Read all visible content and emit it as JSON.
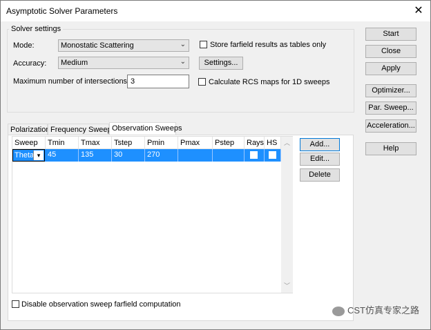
{
  "window": {
    "title": "Asymptotic Solver Parameters",
    "close_glyph": "✕"
  },
  "solver_settings": {
    "group_label": "Solver settings",
    "mode_label": "Mode:",
    "mode_value": "Monostatic Scattering",
    "accuracy_label": "Accuracy:",
    "accuracy_value": "Medium",
    "max_intersections_label": "Maximum number of intersections:",
    "max_intersections_value": "3",
    "store_farfield_label": "Store farfield results as tables only",
    "store_farfield_checked": false,
    "settings_button": "Settings...",
    "calc_rcs_label": "Calculate RCS maps for 1D sweeps",
    "calc_rcs_checked": false
  },
  "right_buttons": [
    "Start",
    "Close",
    "Apply",
    "Optimizer...",
    "Par. Sweep...",
    "Acceleration...",
    "Help"
  ],
  "tabs": [
    {
      "label": "Polarization",
      "active": false
    },
    {
      "label": "Frequency Sweeps",
      "active": false
    },
    {
      "label": "Observation Sweeps",
      "active": true
    }
  ],
  "grid": {
    "columns": [
      "Sweep",
      "Tmin",
      "Tmax",
      "Tstep",
      "Pmin",
      "Pmax",
      "Pstep",
      "Rays",
      "HS"
    ],
    "rows": [
      {
        "sweep": "Theta",
        "tmin": "45",
        "tmax": "135",
        "tstep": "30",
        "pmin": "270",
        "pmax": "",
        "pstep": "",
        "rays": false,
        "hs": false
      }
    ]
  },
  "grid_buttons": [
    "Add...",
    "Edit...",
    "Delete"
  ],
  "disable_farfield_label": "Disable observation sweep farfield computation",
  "disable_farfield_checked": false,
  "watermark": "CST仿真专家之路",
  "colors": {
    "selection": "#1e90ff",
    "window_bg": "#f0f0f0"
  }
}
